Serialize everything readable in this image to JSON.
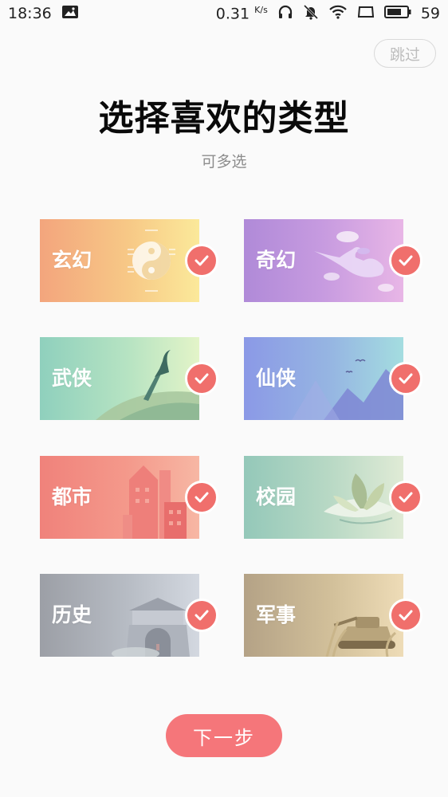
{
  "status_bar": {
    "time": "18:36",
    "net_speed": "0.31",
    "net_unit": "K/s",
    "battery": "59"
  },
  "skip_label": "跳过",
  "title": "选择喜欢的类型",
  "subtitle": "可多选",
  "categories": [
    {
      "label": "玄幻",
      "selected": true
    },
    {
      "label": "奇幻",
      "selected": true
    },
    {
      "label": "武侠",
      "selected": true
    },
    {
      "label": "仙侠",
      "selected": true
    },
    {
      "label": "都市",
      "selected": true
    },
    {
      "label": "校园",
      "selected": true
    },
    {
      "label": "历史",
      "selected": true
    },
    {
      "label": "军事",
      "selected": true
    }
  ],
  "next_label": "下一步",
  "colors": {
    "accent": "#f06f6c",
    "button": "#f5767a"
  }
}
